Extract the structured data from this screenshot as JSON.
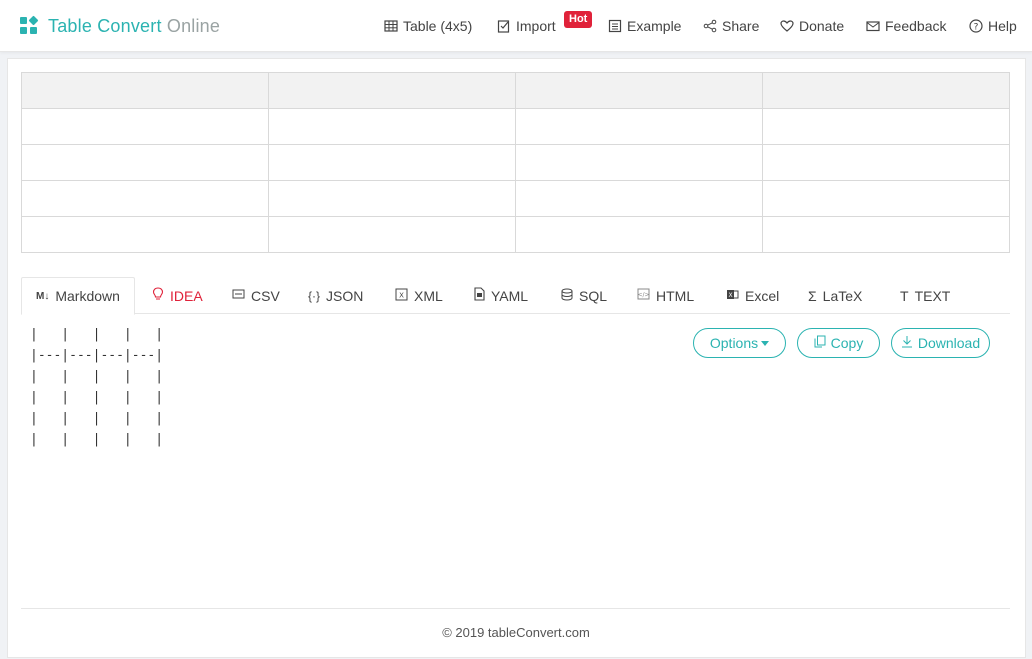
{
  "brand": {
    "name": "Table Convert",
    "suffix": "Online",
    "color": "#2bb3b1"
  },
  "nav": {
    "table": "Table (4x5)",
    "import": "Import",
    "hot_badge": "Hot",
    "example": "Example",
    "share": "Share",
    "donate": "Donate",
    "feedback": "Feedback",
    "help": "Help"
  },
  "tabs": [
    {
      "label": "Markdown",
      "icon": "markdown-icon",
      "active": true
    },
    {
      "label": "IDEA",
      "icon": "lightbulb-icon"
    },
    {
      "label": "CSV",
      "icon": "csv-icon"
    },
    {
      "label": "JSON",
      "icon": "braces-icon"
    },
    {
      "label": "XML",
      "icon": "xml-icon"
    },
    {
      "label": "YAML",
      "icon": "file-icon"
    },
    {
      "label": "SQL",
      "icon": "database-icon"
    },
    {
      "label": "HTML",
      "icon": "code-icon"
    },
    {
      "label": "Excel",
      "icon": "excel-icon"
    },
    {
      "label": "LaTeX",
      "icon": "sigma-icon"
    },
    {
      "label": "TEXT",
      "icon": "text-icon"
    }
  ],
  "buttons": {
    "options": "Options",
    "copy": "Copy",
    "download": "Download"
  },
  "output": {
    "text": "|   |   |   |   |\n|---|---|---|---|\n|   |   |   |   |\n|   |   |   |   |\n|   |   |   |   |\n|   |   |   |   |"
  },
  "footer": "© 2019 tableConvert.com"
}
